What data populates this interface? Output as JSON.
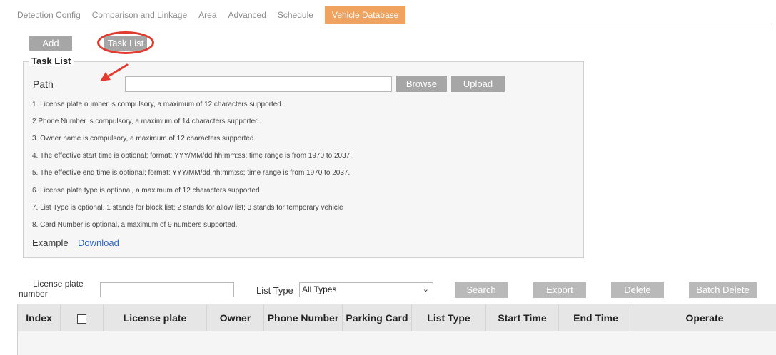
{
  "tabs": [
    {
      "label": "Detection Config"
    },
    {
      "label": "Comparison and Linkage"
    },
    {
      "label": "Area"
    },
    {
      "label": "Advanced"
    },
    {
      "label": "Schedule"
    },
    {
      "label": "Vehicle Database"
    }
  ],
  "active_tab": "Vehicle Database",
  "toolbar": {
    "add_label": "Add",
    "tasklist_label": "Task List"
  },
  "task_list": {
    "legend": "Task List",
    "path_label": "Path",
    "path_value": "",
    "browse_label": "Browse",
    "upload_label": "Upload",
    "notes": [
      "1. License plate number is compulsory, a maximum of 12 characters supported.",
      "2.Phone Number is compulsory, a maximum of 14 characters supported.",
      "3. Owner name is compulsory, a maximum of 12 characters supported.",
      "4. The effective start time is optional; format: YYY/MM/dd hh:mm:ss; time range is from 1970 to 2037.",
      "5. The effective end time is optional; format: YYY/MM/dd hh:mm:ss; time range is from 1970 to 2037.",
      "6. License plate type is optional, a maximum of 12 characters supported.",
      "7. List Type is optional. 1 stands for block list; 2 stands for allow list; 3 stands for temporary vehicle",
      "8. Card Number is optional, a maximum of 9 numbers supported."
    ],
    "example_label": "Example",
    "download_label": "Download"
  },
  "search": {
    "plate_label_line1": "License plate",
    "plate_label_line2": "number",
    "plate_value": "",
    "listtype_label": "List Type",
    "listtype_value": "All Types",
    "search_label": "Search",
    "export_label": "Export",
    "delete_label": "Delete",
    "batch_delete_label": "Batch Delete"
  },
  "table": {
    "columns": [
      "Index",
      "",
      "License plate",
      "Owner",
      "Phone Number",
      "Parking Card",
      "List Type",
      "Start Time",
      "End Time",
      "Operate"
    ],
    "rows": []
  },
  "colors": {
    "accent": "#f0a35e",
    "button": "#a6a6a6",
    "annotation": "#e23a2e",
    "link": "#2b63c9"
  },
  "icons": {
    "select": "chevron-down-icon",
    "header_checkbox": "checkbox-icon",
    "annotation": "red-arrow-icon"
  }
}
